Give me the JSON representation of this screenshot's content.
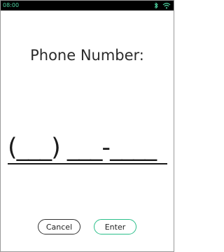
{
  "status_bar": {
    "time": "08:00",
    "icons": [
      "bluetooth-icon",
      "wifi-icon"
    ],
    "accent_color": "#4fd6a3"
  },
  "screen": {
    "title": "Phone Number:",
    "phone_value": "(___) ___-____"
  },
  "buttons": {
    "cancel_label": "Cancel",
    "enter_label": "Enter",
    "enter_border_color": "#2bbf8a"
  }
}
